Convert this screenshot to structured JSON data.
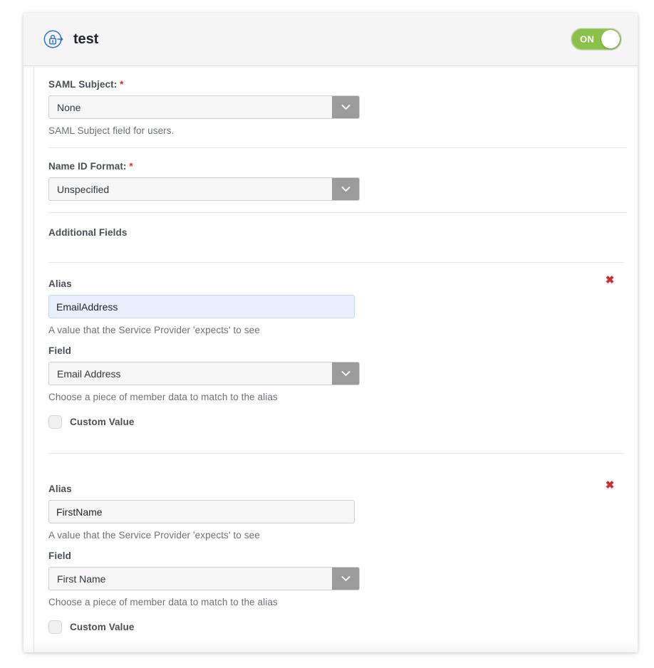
{
  "header": {
    "icon": "sso-lock-arrow-icon",
    "title": "test",
    "toggle": {
      "label": "ON",
      "state": "on",
      "color": "#8ac249"
    }
  },
  "form": {
    "saml_subject": {
      "label": "SAML Subject:",
      "required_marker": "*",
      "value": "None",
      "help": "SAML Subject field for users."
    },
    "name_id_format": {
      "label": "Name ID Format:",
      "required_marker": "*",
      "value": "Unspecified",
      "help": ""
    },
    "additional_fields": {
      "heading": "Additional Fields",
      "alias_label": "Alias",
      "alias_help": "A value that the Service Provider 'expects' to see",
      "field_label": "Field",
      "field_help": "Choose a piece of member data to match to the alias",
      "custom_value_label": "Custom Value",
      "remove_icon": "✖",
      "rows": [
        {
          "alias": "EmailAddress",
          "alias_highlighted": true,
          "field": "Email Address",
          "custom_value_checked": false
        },
        {
          "alias": "FirstName",
          "alias_highlighted": false,
          "field": "First Name",
          "custom_value_checked": false
        }
      ]
    }
  },
  "colors": {
    "required": "#d93025",
    "remove": "#c9302c",
    "toggle_on": "#8ac249",
    "accent_icon": "#2f73d8",
    "input_highlight": "#e8f0fe"
  }
}
